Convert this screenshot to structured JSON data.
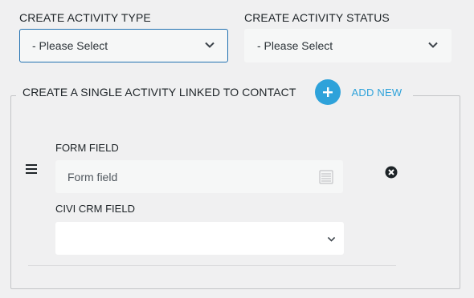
{
  "activity_type": {
    "label": "CREATE ACTIVITY TYPE",
    "selected": "- Please Select"
  },
  "activity_status": {
    "label": "CREATE ACTIVITY STATUS",
    "selected": "- Please Select"
  },
  "linked_section": {
    "legend": "CREATE A SINGLE ACTIVITY LINKED TO CONTACT",
    "add_new_label": "ADD NEW",
    "row": {
      "form_field_label": "FORM FIELD",
      "form_field_value": "Form field",
      "crm_field_label": "CIVI CRM FIELD",
      "crm_field_selected": ""
    }
  },
  "icons": {
    "select_arrow": "chevron-down-icon",
    "add": "plus-circle-icon",
    "drag": "drag-handle-icon",
    "list": "list-icon",
    "remove": "remove-circle-icon"
  },
  "colors": {
    "accent": "#2ea2da",
    "focus_border": "#2271b1"
  }
}
